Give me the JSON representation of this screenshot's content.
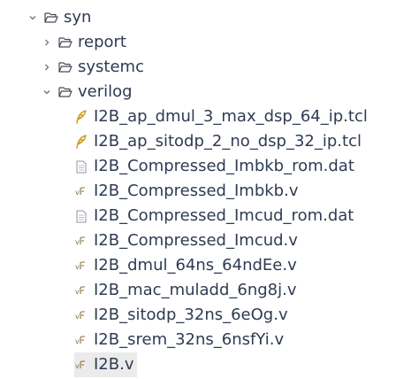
{
  "tree": {
    "root": {
      "label": "syn",
      "expanded": true,
      "chevron_icon": "chevron-down-icon",
      "icon": "folder-open-icon"
    },
    "folders": [
      {
        "label": "report",
        "expanded": false,
        "chevron_icon": "chevron-right-icon",
        "icon": "folder-open-icon"
      },
      {
        "label": "systemc",
        "expanded": false,
        "chevron_icon": "chevron-right-icon",
        "icon": "folder-open-icon"
      },
      {
        "label": "verilog",
        "expanded": true,
        "chevron_icon": "chevron-down-icon",
        "icon": "folder-open-icon"
      }
    ],
    "files": [
      {
        "label": "I2B_ap_dmul_3_max_dsp_64_ip.tcl",
        "icon": "tcl-feather-icon"
      },
      {
        "label": "I2B_ap_sitodp_2_no_dsp_32_ip.tcl",
        "icon": "tcl-feather-icon"
      },
      {
        "label": "I2B_Compressed_Imbkb_rom.dat",
        "icon": "text-file-icon"
      },
      {
        "label": "I2B_Compressed_Imbkb.v",
        "icon": "verilog-file-icon"
      },
      {
        "label": "I2B_Compressed_Imcud_rom.dat",
        "icon": "text-file-icon"
      },
      {
        "label": "I2B_Compressed_Imcud.v",
        "icon": "verilog-file-icon"
      },
      {
        "label": "I2B_dmul_64ns_64ndEe.v",
        "icon": "verilog-file-icon"
      },
      {
        "label": "I2B_mac_muladd_6ng8j.v",
        "icon": "verilog-file-icon"
      },
      {
        "label": "I2B_sitodp_32ns_6eOg.v",
        "icon": "verilog-file-icon"
      },
      {
        "label": "I2B_srem_32ns_6nsfYi.v",
        "icon": "verilog-file-icon"
      },
      {
        "label": "I2B.v",
        "icon": "verilog-file-icon",
        "selected": true
      }
    ]
  },
  "colors": {
    "text": "#2e3b52",
    "chevron": "#6c7a8b",
    "folder_outline": "#444b57",
    "tcl_feather": "#c9a227",
    "verilog_icon": "#8a6d3b",
    "selection_bg": "#ebebeb"
  }
}
